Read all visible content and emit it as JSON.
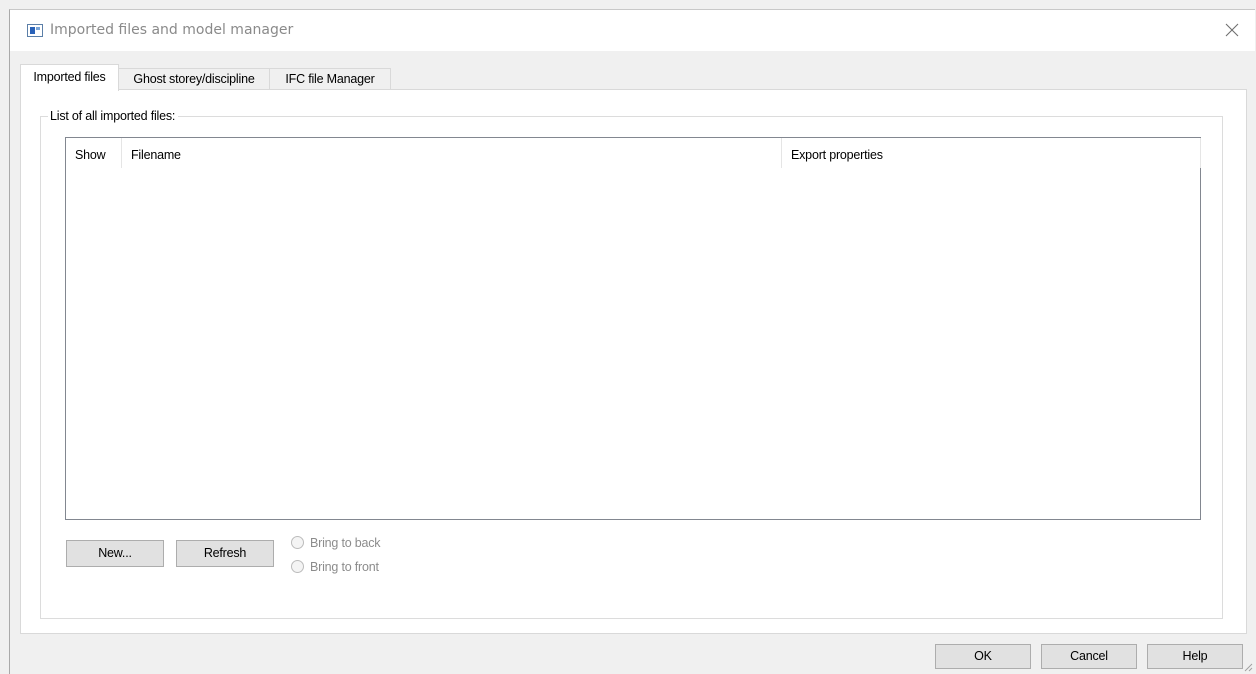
{
  "window": {
    "title": "Imported files and model manager",
    "icon": "app-window-icon",
    "close_icon": "close-icon"
  },
  "tabs": [
    {
      "label": "Imported files",
      "active": true
    },
    {
      "label": "Ghost storey/discipline",
      "active": false
    },
    {
      "label": "IFC file Manager",
      "active": false
    }
  ],
  "imported_files": {
    "group_label": "List of all imported files:",
    "columns": [
      "Show",
      "Filename",
      "Export properties"
    ],
    "rows": [],
    "new_button": "New...",
    "refresh_button": "Refresh",
    "bring_to_back": "Bring to back",
    "bring_to_front": "Bring to front"
  },
  "footer": {
    "ok": "OK",
    "cancel": "Cancel",
    "help": "Help"
  }
}
